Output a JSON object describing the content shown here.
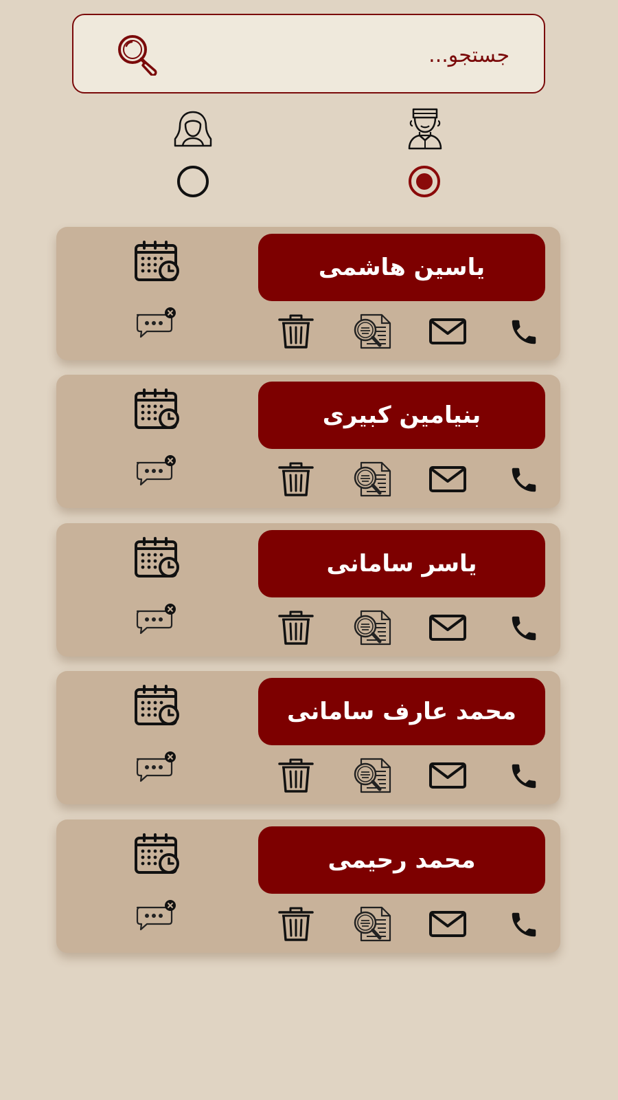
{
  "search": {
    "placeholder": "جستجو...",
    "value": ""
  },
  "gender": {
    "options": [
      {
        "id": "male",
        "icon": "man-avatar-icon",
        "selected": true
      },
      {
        "id": "female",
        "icon": "woman-avatar-icon",
        "selected": false
      }
    ]
  },
  "contacts": [
    {
      "name": "یاسین هاشمی"
    },
    {
      "name": "بنیامین کبیری"
    },
    {
      "name": "یاسر سامانی"
    },
    {
      "name": "محمد عارف سامانی"
    },
    {
      "name": "محمد رحیمی"
    }
  ],
  "colors": {
    "background": "#e0d4c3",
    "card": "#c8b29a",
    "accent": "#7d0000",
    "search_bg": "#efe9dc"
  }
}
